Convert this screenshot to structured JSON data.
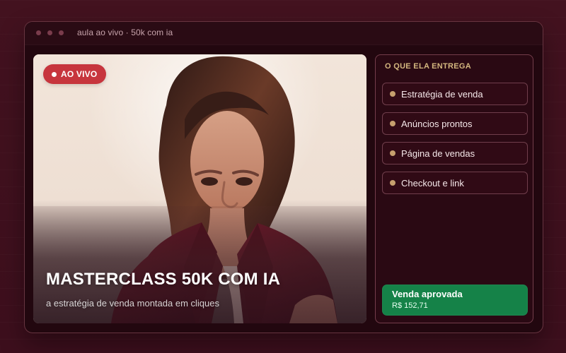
{
  "window": {
    "title": "aula ao vivo · 50k com ia"
  },
  "video": {
    "badge": "AO VIVO",
    "title": "MASTERCLASS 50K COM IA",
    "subtitle": "a estratégia de venda montada em cliques",
    "badge_color": "#c7353d"
  },
  "panel": {
    "heading": "O QUE ELA ENTREGA",
    "items": [
      {
        "label": "Estratégia de venda"
      },
      {
        "label": "Anúncios prontos"
      },
      {
        "label": "Página de vendas"
      },
      {
        "label": "Checkout e link"
      }
    ]
  },
  "sale": {
    "title": "Venda aprovada",
    "value": "R$ 152,71",
    "color": "#158248"
  },
  "colors": {
    "background": "#3f1121",
    "window": "#22070f",
    "accent_gold": "#d4b77f",
    "panel_border": "#aa6474"
  }
}
